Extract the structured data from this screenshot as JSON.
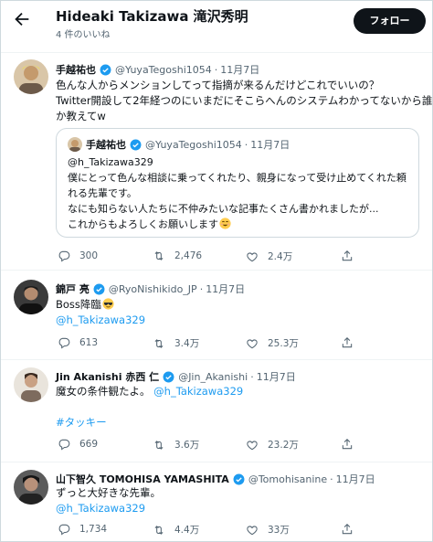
{
  "header": {
    "title": "Hideaki Takizawa 滝沢秀明",
    "subtitle": "4 件のいいね",
    "follow_label": "フォロー"
  },
  "colors": {
    "link": "#1d9bf0",
    "verified": "#1d9bf0",
    "follow_bg": "#0f1419"
  },
  "tweets": [
    {
      "display_name": "手越祐也",
      "handle": "@YuyaTegoshi1054",
      "separator": "·",
      "time": "11月7日",
      "lines": [
        "色んな人からメンションしてって指摘が来るんだけどこれでいいの？",
        "Twitter開設して2年経つのにいまだにそこらへんのシステムわかってないから誰",
        "か教えてw"
      ],
      "quote": {
        "display_name": "手越祐也",
        "handle": "@YuyaTegoshi1054",
        "separator": "·",
        "time": "11月7日",
        "lines": [
          "@h_Takizawa329",
          "僕にとって色んな相談に乗ってくれたり、親身になって受け止めてくれた頼",
          "れる先輩です。",
          "なにも知らない人たちに不仲みたいな記事たくさん書かれましたが...",
          "これからもよろしくお願いします"
        ],
        "emoji": "smiling-face-emoji"
      },
      "replies": "300",
      "retweets": "2,476",
      "likes": "2.4万"
    },
    {
      "display_name": "錦戸 亮",
      "handle": "@RyoNishikido_JP",
      "separator": "·",
      "time": "11月7日",
      "line1": "Boss降臨",
      "emoji": "sunglasses-face-emoji",
      "mention": "@h_Takizawa329",
      "replies": "613",
      "retweets": "3.4万",
      "likes": "25.3万"
    },
    {
      "display_name": "Jin Akanishi 赤西 仁",
      "handle": "@Jin_Akanishi",
      "separator": "·",
      "time": "11月7日",
      "line1": "魔女の条件観たよ。",
      "mention": "@h_Takizawa329",
      "hashtag": "#タッキー",
      "replies": "669",
      "retweets": "3.6万",
      "likes": "23.2万"
    },
    {
      "display_name": "山下智久 TOMOHISA YAMASHITA",
      "handle": "@Tomohisanine",
      "separator": "·",
      "time": "11月7日",
      "line1": "ずっと大好きな先輩。",
      "mention": "@h_Takizawa329",
      "replies": "1,734",
      "retweets": "4.4万",
      "likes": "33万"
    }
  ]
}
